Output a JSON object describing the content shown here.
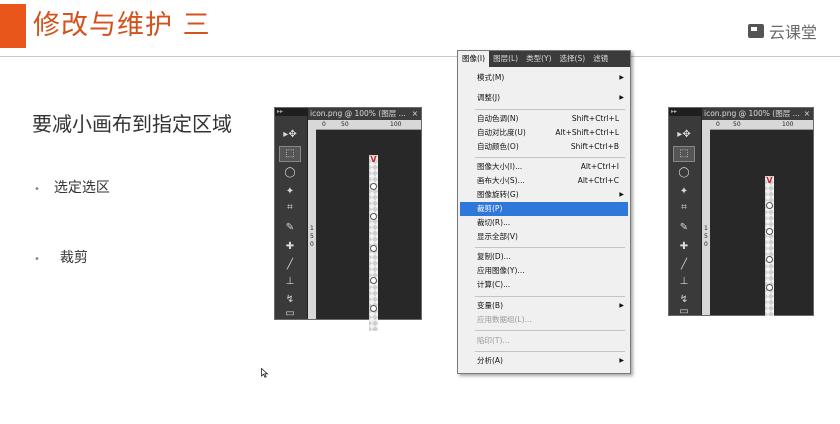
{
  "slide": {
    "title": "修改与维护 三",
    "logo_text": "云课堂",
    "heading": "要减小画布到指定区域",
    "bullets": [
      "选定选区",
      "裁剪"
    ]
  },
  "ps_left": {
    "tab_title": "icon.png @ 100% (图层 ...",
    "close": "×",
    "ruler_marks": [
      "0",
      "50",
      "100"
    ],
    "ruler_side": [
      "1",
      "5",
      "0"
    ]
  },
  "ps_right": {
    "tab_title": "icon.png @ 100% (图层 ...",
    "close": "×",
    "ruler_marks": [
      "0",
      "50",
      "100"
    ],
    "ruler_side": [
      "1",
      "5",
      "0"
    ]
  },
  "menu": {
    "menubar": [
      "图像(I)",
      "图层(L)",
      "类型(Y)",
      "选择(S)",
      "滤镜"
    ],
    "items": [
      {
        "label": "模式(M)",
        "shortcut": "",
        "submenu": true
      },
      {
        "label": "调整(J)",
        "shortcut": "",
        "submenu": true
      },
      {
        "label": "自动色调(N)",
        "shortcut": "Shift+Ctrl+L"
      },
      {
        "label": "自动对比度(U)",
        "shortcut": "Alt+Shift+Ctrl+L"
      },
      {
        "label": "自动颜色(O)",
        "shortcut": "Shift+Ctrl+B"
      },
      {
        "label": "图像大小(I)...",
        "shortcut": "Alt+Ctrl+I"
      },
      {
        "label": "画布大小(S)...",
        "shortcut": "Alt+Ctrl+C"
      },
      {
        "label": "图像旋转(G)",
        "shortcut": "",
        "submenu": true
      },
      {
        "label": "裁剪(P)",
        "shortcut": "",
        "highlighted": true
      },
      {
        "label": "裁切(R)...",
        "shortcut": ""
      },
      {
        "label": "显示全部(V)",
        "shortcut": ""
      },
      {
        "label": "复制(D)...",
        "shortcut": ""
      },
      {
        "label": "应用图像(Y)...",
        "shortcut": ""
      },
      {
        "label": "计算(C)...",
        "shortcut": ""
      },
      {
        "label": "变量(B)",
        "shortcut": "",
        "submenu": true
      },
      {
        "label": "应用数据组(L)...",
        "shortcut": "",
        "disabled": true
      },
      {
        "label": "陷印(T)...",
        "shortcut": "",
        "disabled": true
      },
      {
        "label": "分析(A)",
        "shortcut": "",
        "submenu": true
      }
    ]
  },
  "colors": {
    "accent": "#e8561b",
    "title": "#d4521c",
    "highlight": "#2f77d9"
  }
}
